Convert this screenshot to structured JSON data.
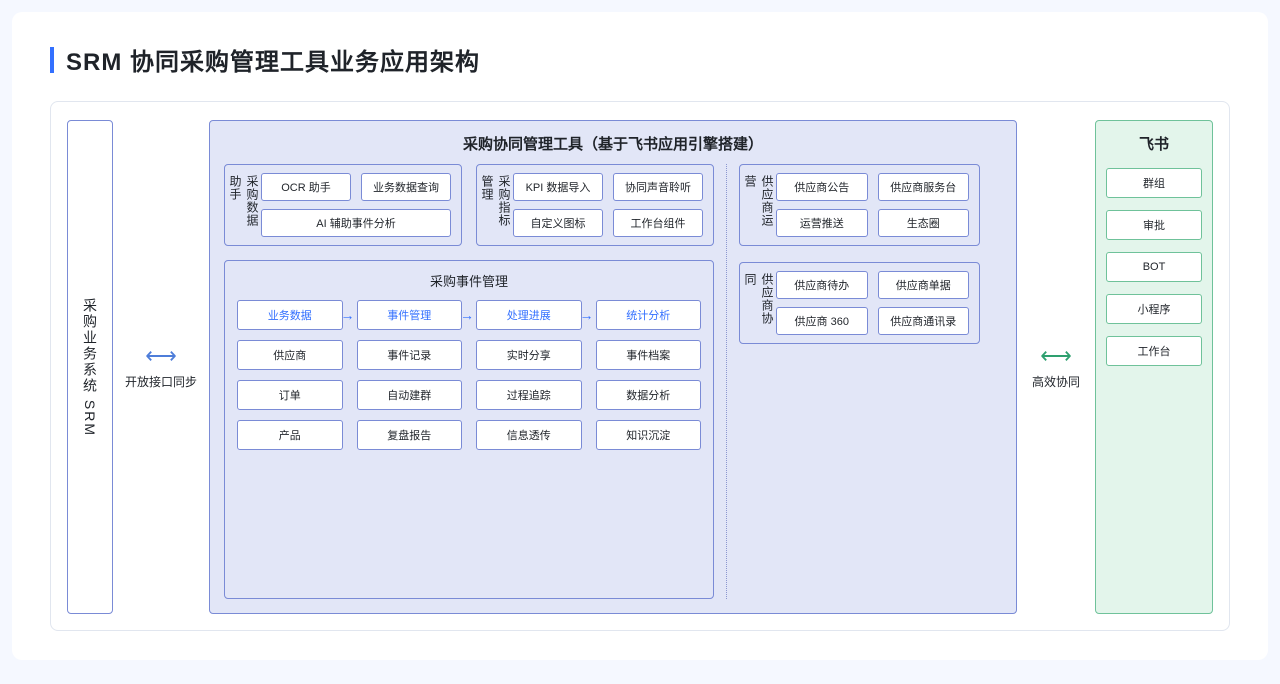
{
  "title": "SRM 协同采购管理工具业务应用架构",
  "srm_label": "采购业务系统 SRM",
  "connector_left": "开放接口同步",
  "connector_right": "高效协同",
  "center": {
    "title": "采购协同管理工具（基于飞书应用引擎搭建）",
    "data_helper": {
      "label": "采购数据助手",
      "row1": [
        "OCR 助手",
        "业务数据查询"
      ],
      "row2": [
        "AI 辅助事件分析"
      ]
    },
    "metric": {
      "label": "采购指标管理",
      "row1": [
        "KPI 数据导入",
        "协同声音聆听"
      ],
      "row2": [
        "自定义图标",
        "工作台组件"
      ]
    },
    "event": {
      "title": "采购事件管理",
      "flow": [
        "业务数据",
        "事件管理",
        "处理进展",
        "统计分析"
      ],
      "grid": [
        [
          "供应商",
          "事件记录",
          "实时分享",
          "事件档案"
        ],
        [
          "订单",
          "自动建群",
          "过程追踪",
          "数据分析"
        ],
        [
          "产品",
          "复盘报告",
          "信息透传",
          "知识沉淀"
        ]
      ]
    },
    "supplier_ops": {
      "label": "供应商运营",
      "row1": [
        "供应商公告",
        "供应商服务台"
      ],
      "row2": [
        "运营推送",
        "生态圈"
      ]
    },
    "supplier_collab": {
      "label": "供应商协同",
      "row1": [
        "供应商待办",
        "供应商单据"
      ],
      "row2": [
        "供应商 360",
        "供应商通讯录"
      ]
    }
  },
  "feishu": {
    "title": "飞书",
    "items": [
      "群组",
      "审批",
      "BOT",
      "小程序",
      "工作台"
    ]
  }
}
